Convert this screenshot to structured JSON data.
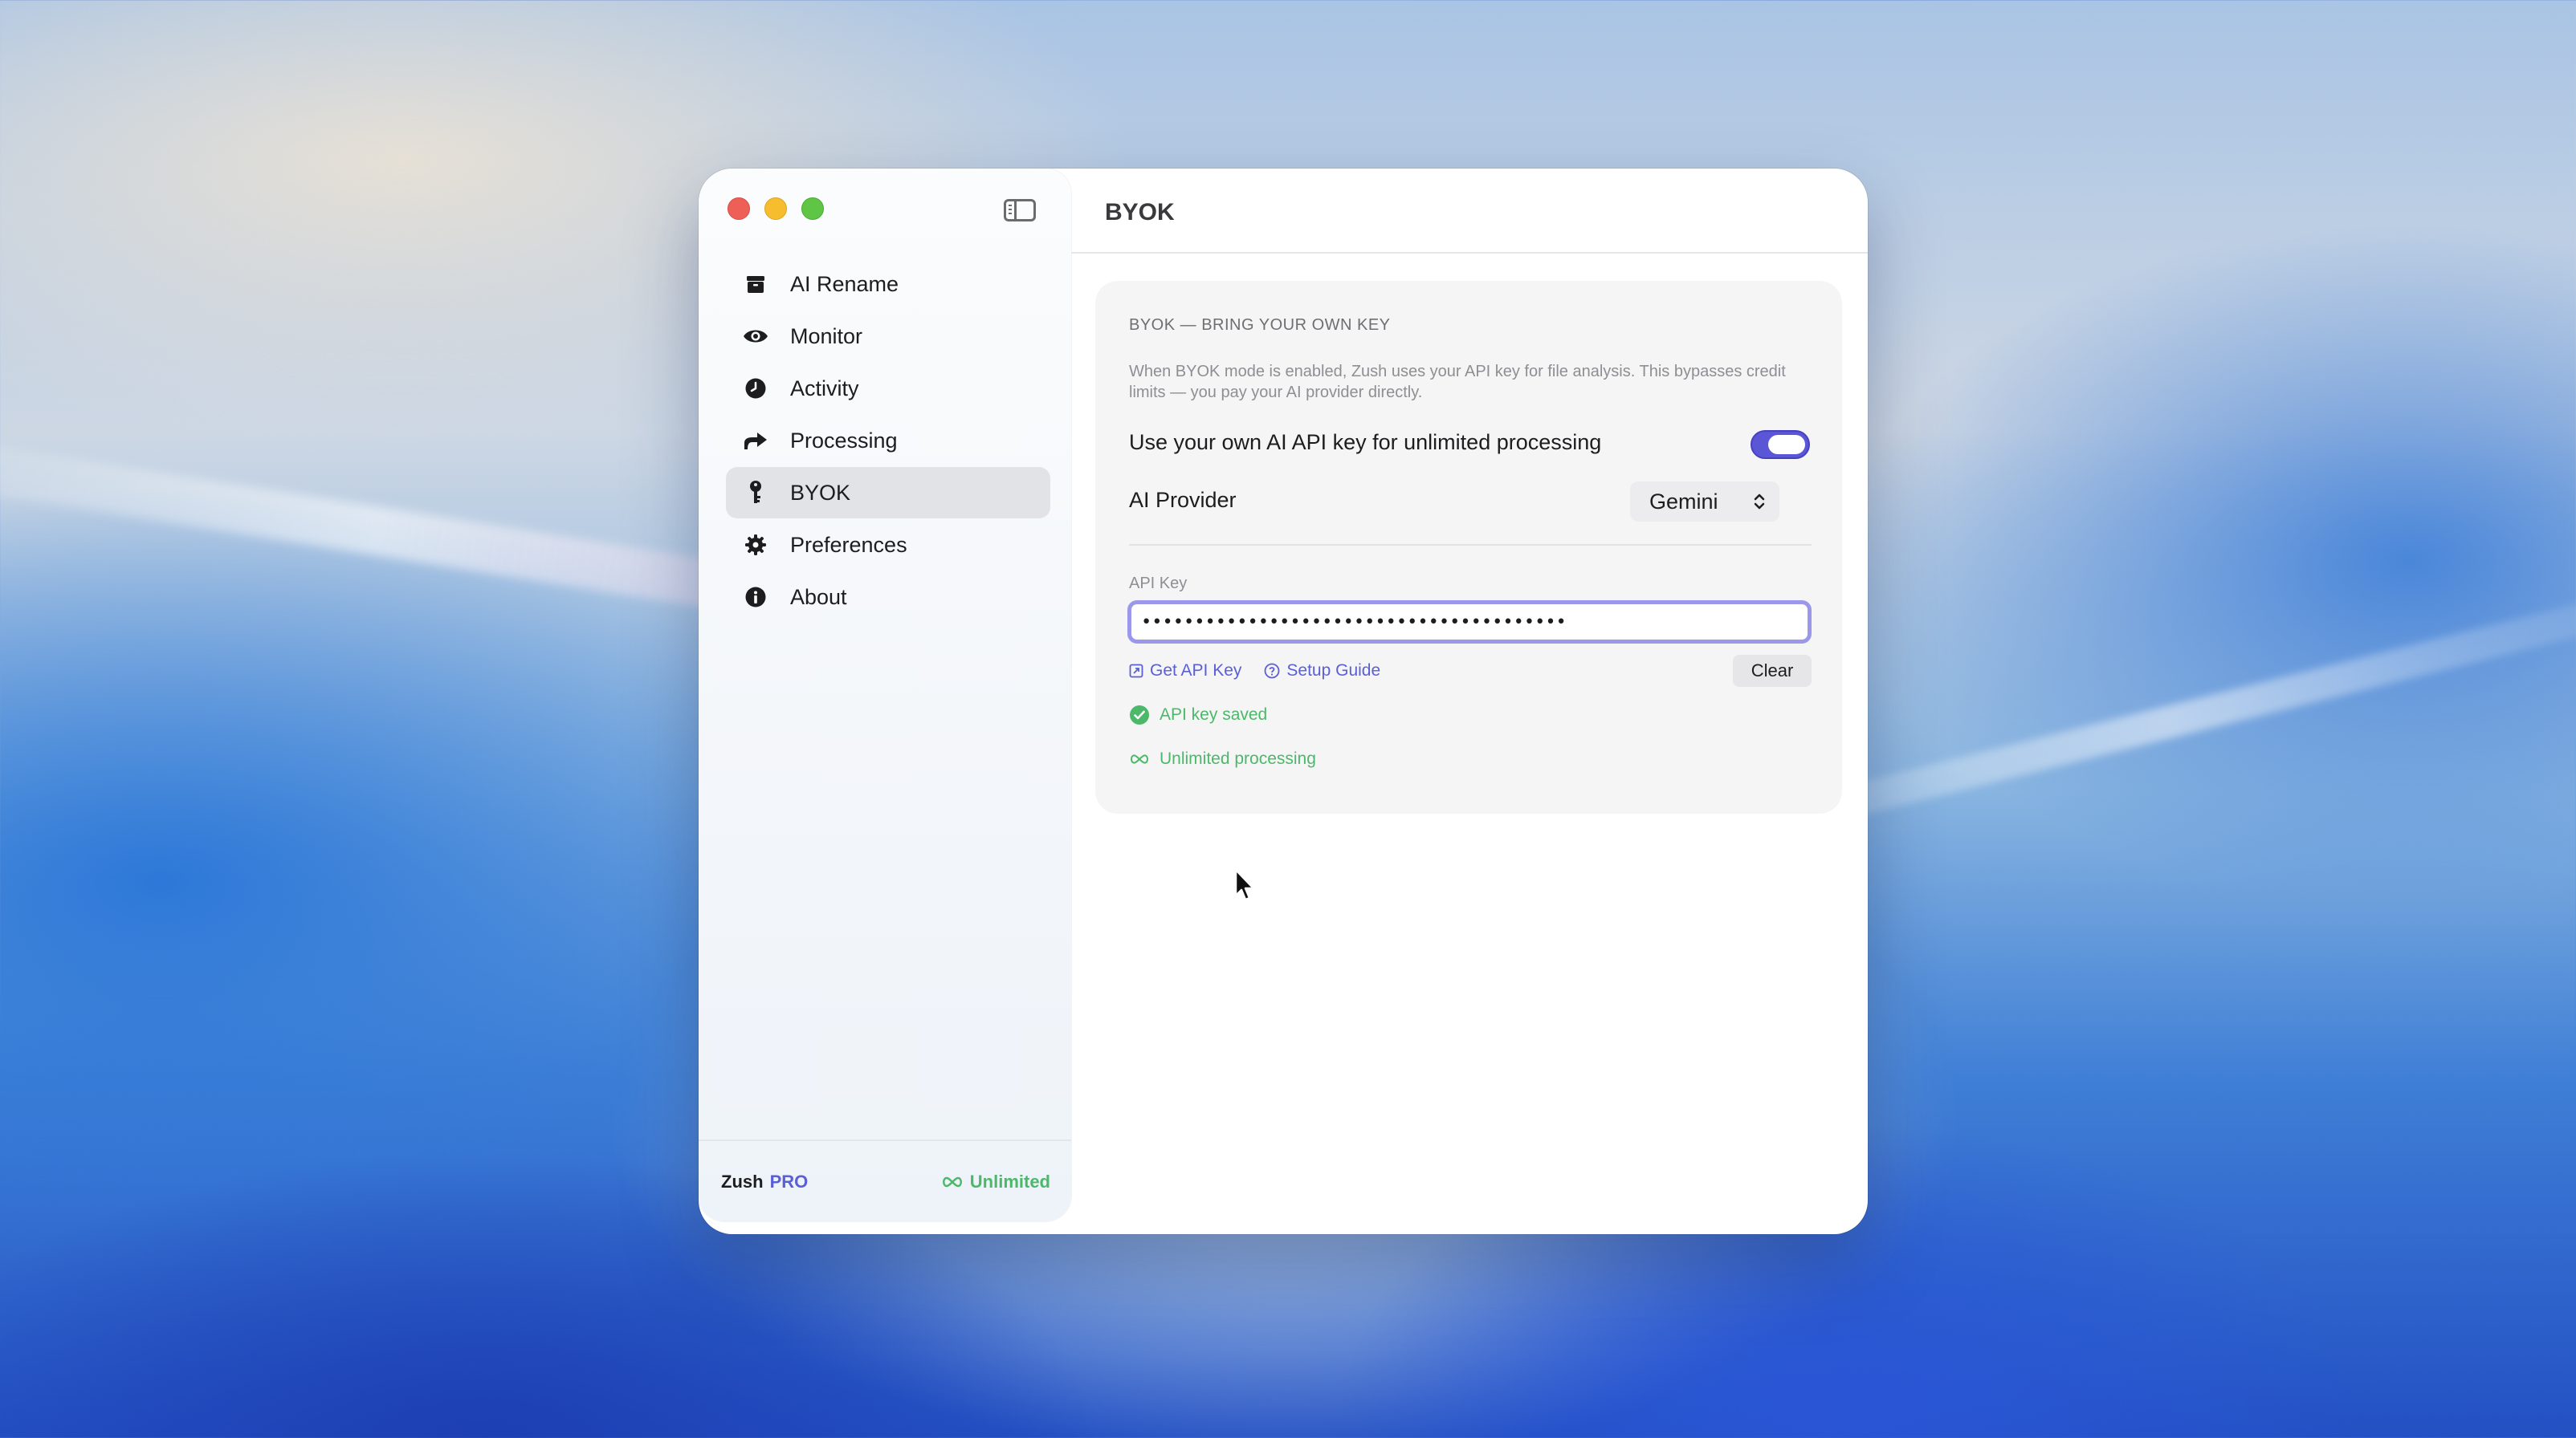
{
  "window": {
    "title": "BYOK"
  },
  "sidebar": {
    "items": [
      {
        "label": "AI Rename",
        "icon": "archive-icon"
      },
      {
        "label": "Monitor",
        "icon": "eye-icon"
      },
      {
        "label": "Activity",
        "icon": "clock-icon"
      },
      {
        "label": "Processing",
        "icon": "arrow-share-icon"
      },
      {
        "label": "BYOK",
        "icon": "key-icon",
        "selected": true
      },
      {
        "label": "Preferences",
        "icon": "gear-icon"
      },
      {
        "label": "About",
        "icon": "info-icon"
      }
    ],
    "footer": {
      "brand": "Zush",
      "tier": "PRO",
      "plan": "Unlimited"
    }
  },
  "byok": {
    "section_title": "BYOK — BRING YOUR OWN KEY",
    "description": "When BYOK mode is enabled, Zush uses your API key for file analysis. This bypasses credit limits — you pay your AI provider directly.",
    "toggle_label": "Use your own AI API key for unlimited processing",
    "toggle_on": true,
    "provider_label": "AI Provider",
    "provider_value": "Gemini",
    "api_key_label": "API Key",
    "api_key_value": "••••••••••••••••••••••••••••••••••••••••",
    "get_key_label": "Get API Key",
    "setup_guide_label": "Setup Guide",
    "clear_label": "Clear",
    "saved_status": "API key saved",
    "unlimited_status": "Unlimited processing"
  },
  "colors": {
    "accent": "#5a56d6",
    "success": "#4cb86a",
    "selected_bg": "#e2e3e6"
  }
}
